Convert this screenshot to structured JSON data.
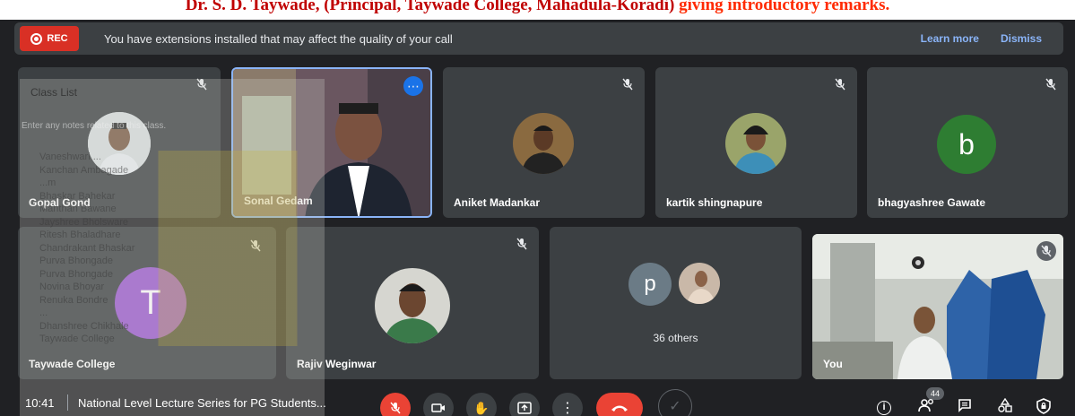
{
  "caption": {
    "part1": "Dr. S. D. Taywade, (Principal, Taywade College, Mahadula-Koradi)",
    "part2": " giving introductory remarks."
  },
  "banner": {
    "rec_label": "REC",
    "message": "You have extensions installed that may affect the quality of your call",
    "learn_more": "Learn more",
    "dismiss": "Dismiss"
  },
  "tiles": {
    "gopal": "Gopal Gond",
    "sonal": "Sonal Gedam",
    "aniket": "Aniket Madankar",
    "kartik": "kartik shingnapure",
    "bhagyashree": "bhagyashree Gawate",
    "bhagyashree_letter": "b",
    "taywade": "Taywade College",
    "taywade_letter": "T",
    "rajiv": "Rajiv Weginwar",
    "others_letter": "p",
    "others": "36 others",
    "you": "You"
  },
  "overlay": {
    "title": "Class List",
    "note": "Enter any notes related to this class.",
    "names": [
      "Vaneshwari ...",
      "Kanchan Ambagade",
      "...m",
      "Bhaskar Bahekar",
      "Manthan Bawane",
      "Jayshree Bholsware",
      "Ritesh Bhaladhare",
      "Chandrakant Bhaskar",
      "Purva Bhongade",
      "Purva Bhongade",
      "Novina Bhoyar",
      "Renuka Bondre",
      "...",
      "Dhanshree Chikhale",
      "Taywade College"
    ]
  },
  "controls": {
    "time": "10:41",
    "meeting_title": "National Level Lecture Series for PG Students...",
    "people_count": "44"
  },
  "colors": {
    "background": "#202124",
    "tile": "#3c4043",
    "rec": "#d93025",
    "end_call": "#ea4335",
    "link": "#8ab4f8",
    "active_border": "#8ab4f8",
    "bhagyashree_avatar": "#2e7d32",
    "taywade_avatar": "#9b59d0",
    "others_avatar": "#6b7b86"
  }
}
